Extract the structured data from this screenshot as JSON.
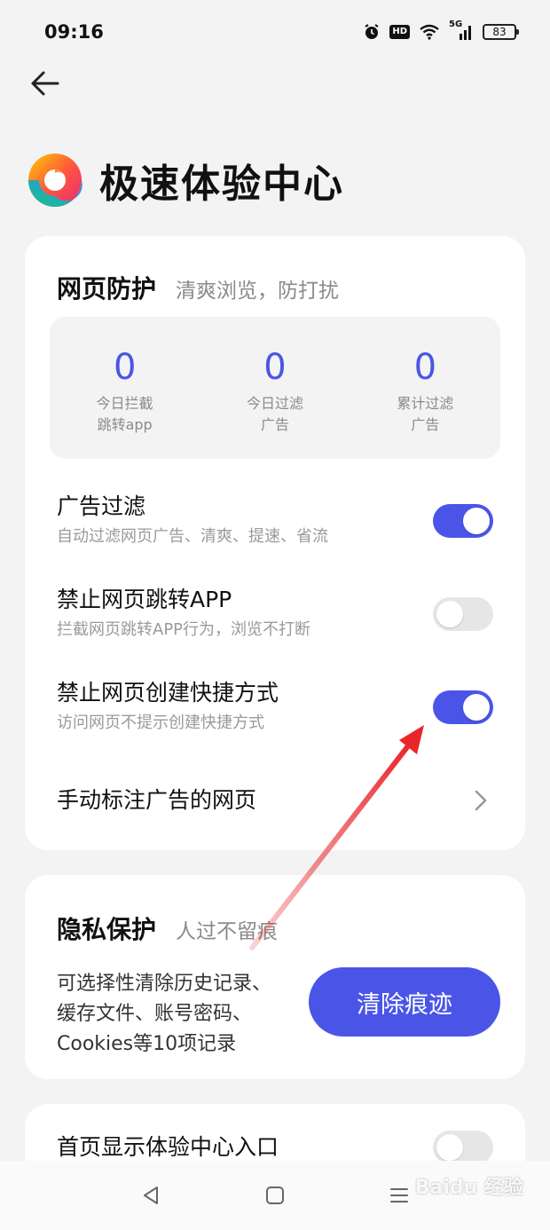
{
  "status_bar": {
    "time": "09:16",
    "battery": "83",
    "hd_label": "HD",
    "network": "5G"
  },
  "header": {
    "title": "极速体验中心",
    "logo_icon": "swirl-logo-icon",
    "back_icon": "back-arrow-icon"
  },
  "web_protection": {
    "title": "网页防护",
    "subtitle": "清爽浏览，防打扰",
    "stats": [
      {
        "value": "0",
        "label": "今日拦截\n跳转app"
      },
      {
        "value": "0",
        "label": "今日过滤\n广告"
      },
      {
        "value": "0",
        "label": "累计过滤\n广告"
      }
    ],
    "settings": [
      {
        "title": "广告过滤",
        "desc": "自动过滤网页广告、清爽、提速、省流",
        "enabled": true
      },
      {
        "title": "禁止网页跳转APP",
        "desc": "拦截网页跳转APP行为，浏览不打断",
        "enabled": false
      },
      {
        "title": "禁止网页创建快捷方式",
        "desc": "访问网页不提示创建快捷方式",
        "enabled": true
      }
    ],
    "manual_mark": "手动标注广告的网页"
  },
  "privacy": {
    "title": "隐私保护",
    "subtitle": "人过不留痕",
    "desc": "可选择性清除历史记录、\n缓存文件、账号密码、\nCookies等10项记录",
    "clear_button": "清除痕迹"
  },
  "homepage_entry": {
    "title": "首页显示体验中心入口",
    "enabled": false
  },
  "watermark": "Baidu 经验",
  "colors": {
    "accent": "#4a55e8",
    "toggle_off": "#e6e6e6",
    "card": "#ffffff",
    "background": "#f3f3f3",
    "annotation_arrow": "#e8262a"
  }
}
